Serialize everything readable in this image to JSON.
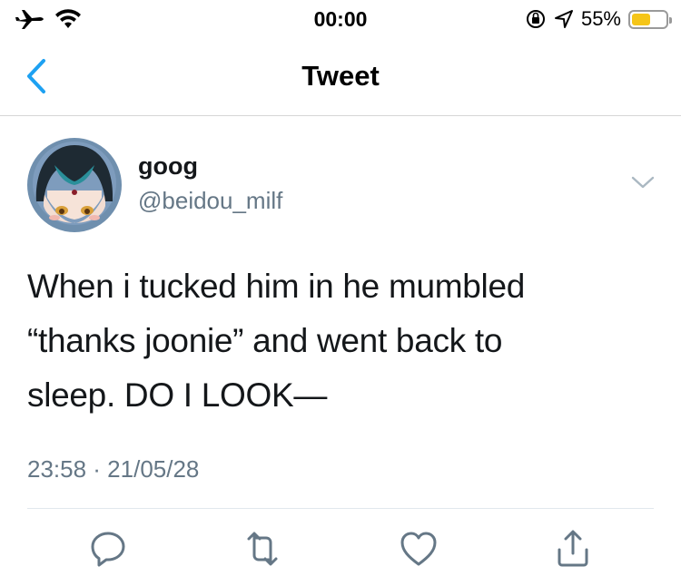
{
  "status_bar": {
    "time": "00:00",
    "battery_percent": "55%",
    "battery_level": 0.55,
    "battery_color": "#f5c518"
  },
  "nav": {
    "title": "Tweet",
    "back_icon": "chevron-left-icon"
  },
  "tweet": {
    "author_name": "goog",
    "author_handle": "@beidou_milf",
    "lines": [
      "When i tucked him in he mumbled",
      "“thanks joonie” and went back to",
      "sleep. DO I LOOK—"
    ],
    "timestamp": "23:58 · 21/05/28"
  },
  "actions": [
    "reply-icon",
    "retweet-icon",
    "like-icon",
    "share-icon"
  ],
  "colors": {
    "accent": "#1da1f2",
    "secondary_text": "#657786",
    "action_icon": "#657786"
  }
}
